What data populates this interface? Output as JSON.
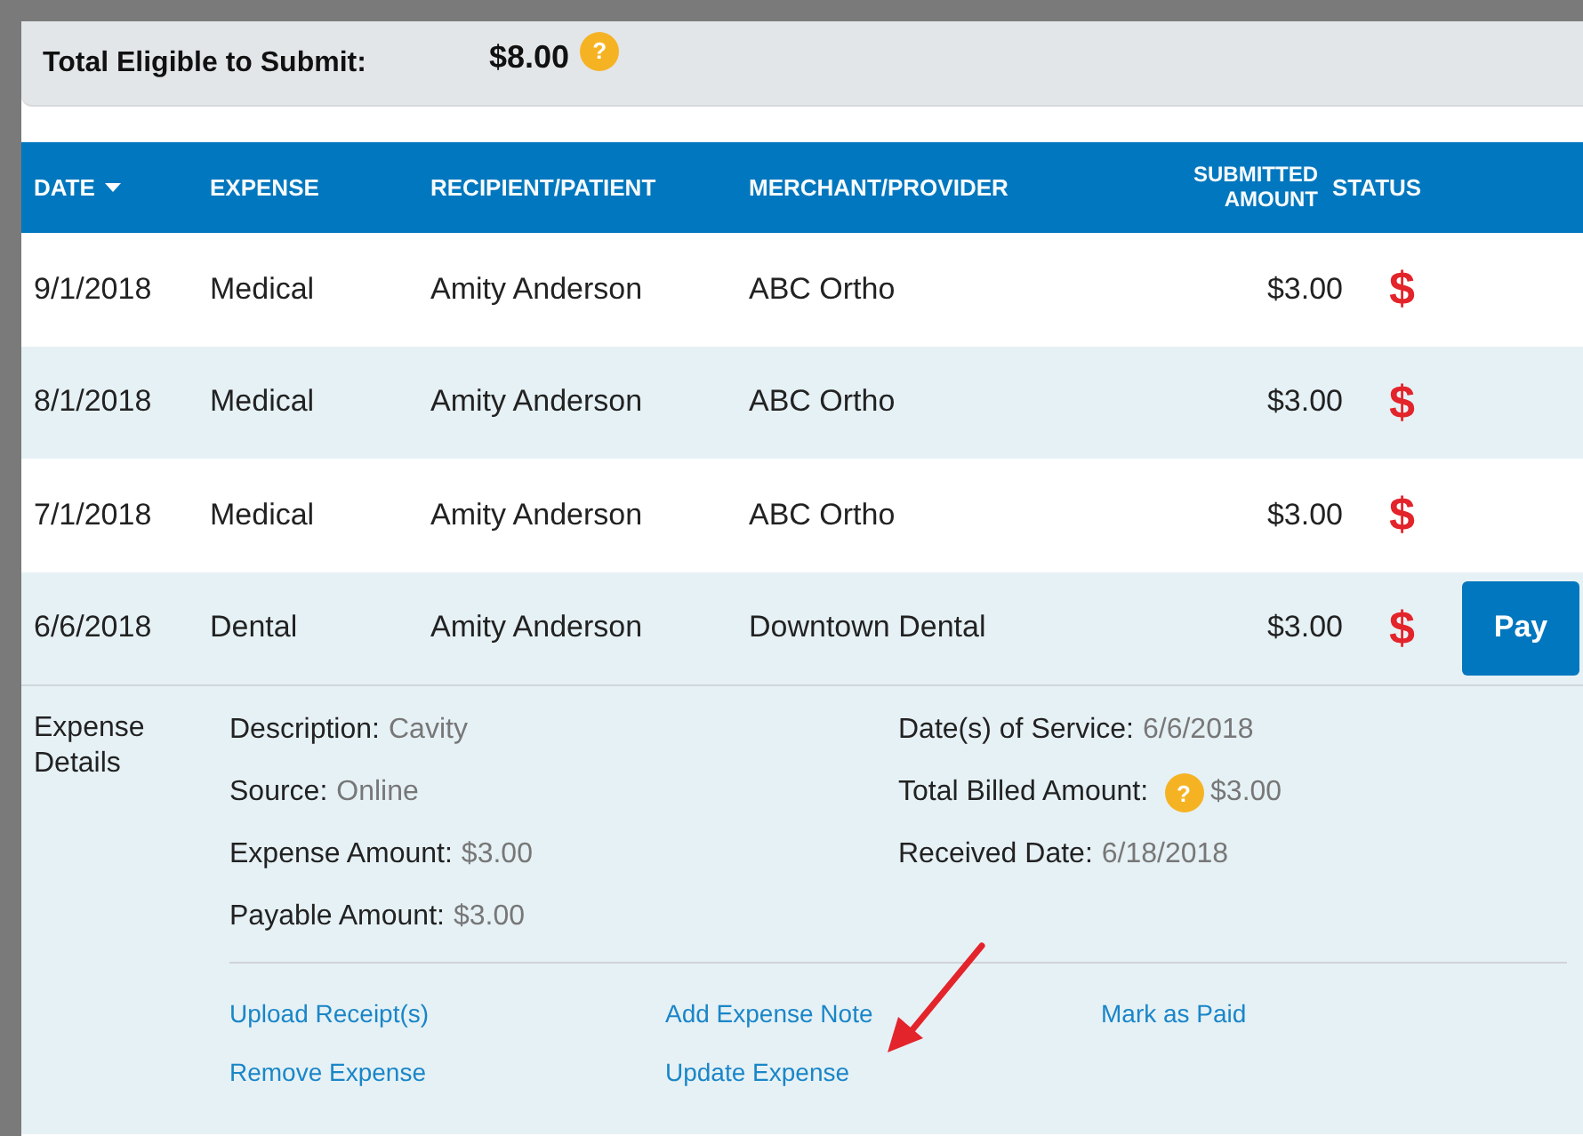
{
  "summary": {
    "label": "Total Eligible to Submit:",
    "value": "$8.00",
    "help": "?"
  },
  "table": {
    "columns": [
      {
        "label": "DATE",
        "sorted": true
      },
      {
        "label": "EXPENSE",
        "sorted": false
      },
      {
        "label": "RECIPIENT/PATIENT",
        "sorted": false
      },
      {
        "label": "MERCHANT/PROVIDER",
        "sorted": false
      },
      {
        "label": "SUBMITTED AMOUNT",
        "sorted": false
      },
      {
        "label": "STATUS",
        "sorted": false
      }
    ],
    "rows": [
      {
        "date": "9/1/2018",
        "expense": "Medical",
        "recipient": "Amity Anderson",
        "merchant": "ABC Ortho",
        "amount": "$3.00",
        "status": "$",
        "expanded": false
      },
      {
        "date": "8/1/2018",
        "expense": "Medical",
        "recipient": "Amity Anderson",
        "merchant": "ABC Ortho",
        "amount": "$3.00",
        "status": "$",
        "expanded": false
      },
      {
        "date": "7/1/2018",
        "expense": "Medical",
        "recipient": "Amity Anderson",
        "merchant": "ABC Ortho",
        "amount": "$3.00",
        "status": "$",
        "expanded": false
      },
      {
        "date": "6/6/2018",
        "expense": "Dental",
        "recipient": "Amity Anderson",
        "merchant": "Downtown Dental",
        "amount": "$3.00",
        "status": "$",
        "expanded": true,
        "action": "Pay"
      }
    ]
  },
  "details": {
    "title": "Expense Details",
    "left": [
      {
        "label": "Description:",
        "value": "Cavity"
      },
      {
        "label": "Source:",
        "value": "Online"
      },
      {
        "label": "Expense Amount:",
        "value": "$3.00"
      },
      {
        "label": "Payable Amount:",
        "value": "$3.00"
      }
    ],
    "right": [
      {
        "label": "Date(s) of Service:",
        "value": "6/6/2018"
      },
      {
        "label": "Total Billed Amount:",
        "value": "$3.00",
        "help": "?"
      },
      {
        "label": "Received Date:",
        "value": "6/18/2018"
      }
    ],
    "links": [
      "Upload Receipt(s)",
      "Add Expense Note",
      "Mark as Paid",
      "Remove Expense",
      "Update Expense"
    ]
  }
}
